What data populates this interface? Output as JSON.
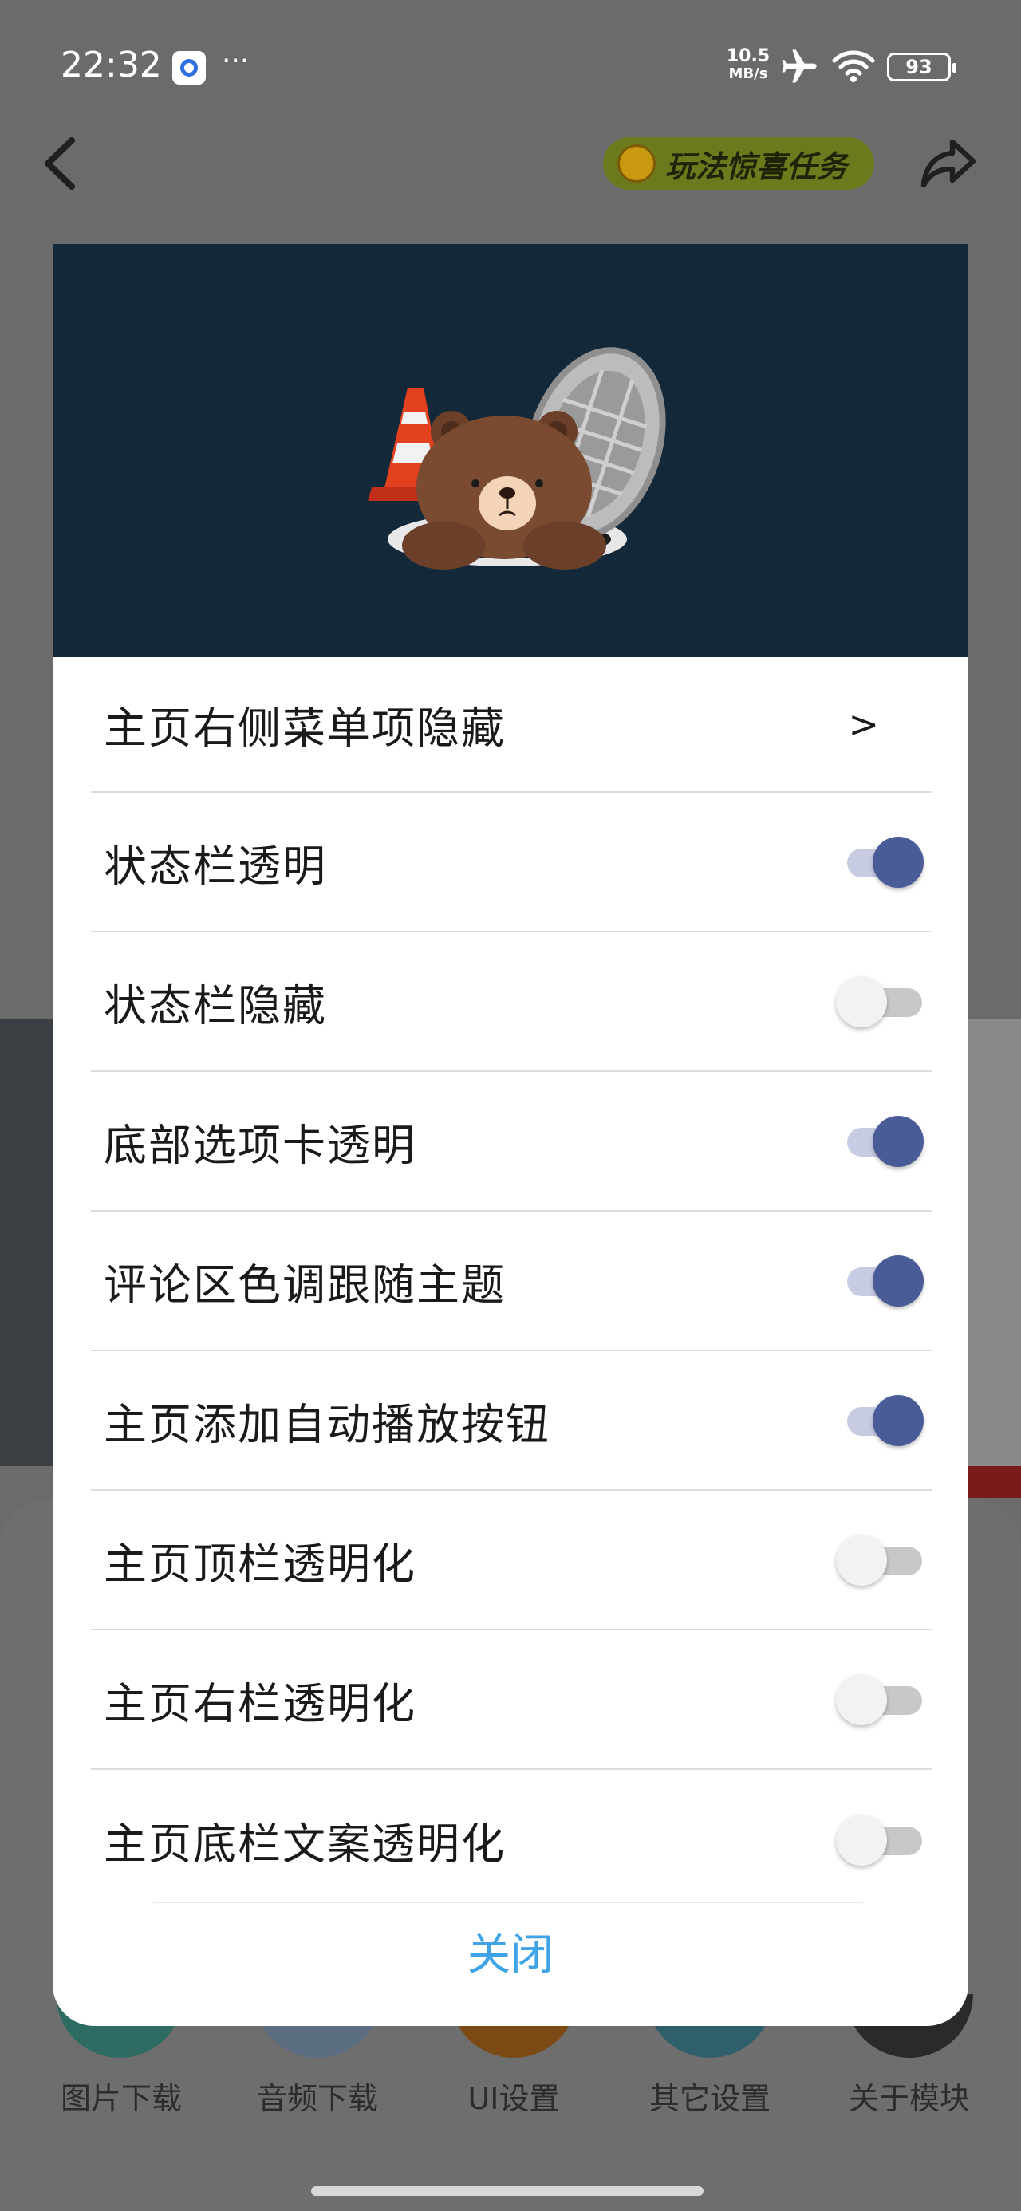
{
  "status_bar": {
    "time": "22:32",
    "dots": "···",
    "net_speed_value": "10.5",
    "net_speed_unit": "MB/s",
    "battery": "93"
  },
  "top_bar": {
    "task_label": "玩法惊喜任务"
  },
  "dialog": {
    "items": [
      {
        "label": "主页右侧菜单项隐藏",
        "type": "link",
        "arrow": ">"
      },
      {
        "label": "状态栏透明",
        "type": "toggle",
        "checked": true
      },
      {
        "label": "状态栏隐藏",
        "type": "toggle",
        "checked": false
      },
      {
        "label": "底部选项卡透明",
        "type": "toggle",
        "checked": true
      },
      {
        "label": "评论区色调跟随主题",
        "type": "toggle",
        "checked": true
      },
      {
        "label": "主页添加自动播放按钮",
        "type": "toggle",
        "checked": true
      },
      {
        "label": "主页顶栏透明化",
        "type": "toggle",
        "checked": false
      },
      {
        "label": "主页右栏透明化",
        "type": "toggle",
        "checked": false
      },
      {
        "label": "主页底栏文案透明化",
        "type": "toggle",
        "checked": false
      }
    ],
    "close_label": "关闭"
  },
  "bottom_tabs": [
    "图片下载",
    "音频下载",
    "UI设置",
    "其它设置",
    "关于模块"
  ],
  "colors": {
    "banner_bg": "#13293a",
    "toggle_on_knob": "#4a5c98",
    "toggle_on_track": "#c7cce3",
    "toggle_off_track": "#c8c8c8",
    "close_text": "#3fa3e8",
    "overlay_bg": "#6b6b6b"
  },
  "icons": {
    "banner": "bear-in-manhole-illustration",
    "back": "chevron-left-icon",
    "share": "share-arrow-icon",
    "airplane": "airplane-icon",
    "wifi": "wifi-icon"
  }
}
